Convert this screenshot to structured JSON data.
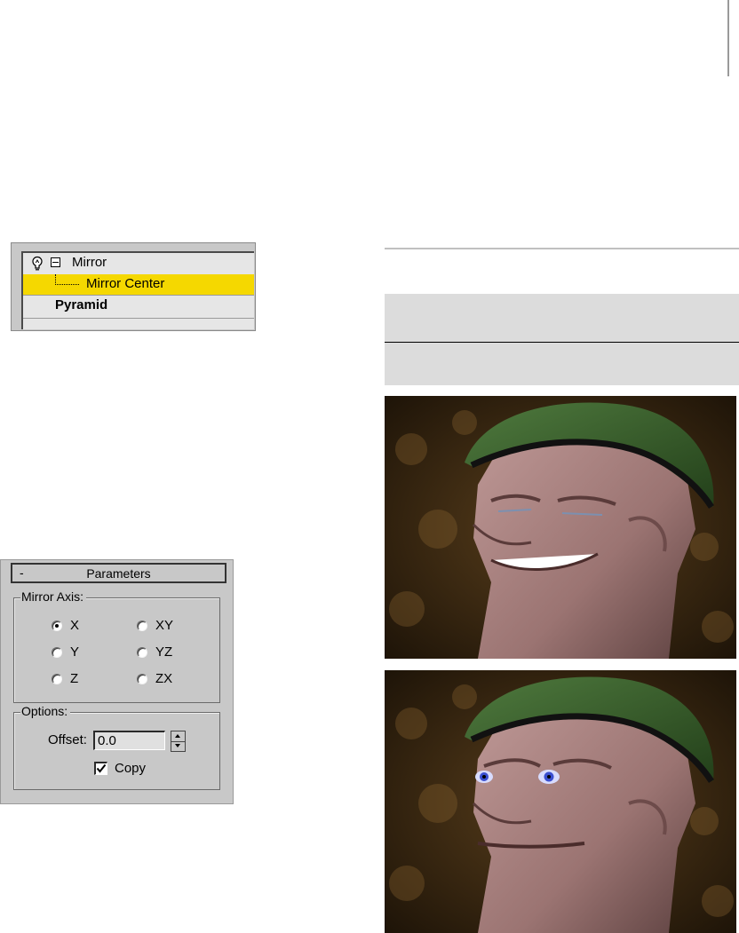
{
  "stack": {
    "items": [
      {
        "label": "Mirror",
        "expanded": true
      },
      {
        "label": "Mirror Center",
        "selected": true
      },
      {
        "label": "Pyramid"
      }
    ],
    "selected_color": "#f5d800"
  },
  "parameters": {
    "collapse_glyph": "-",
    "title": "Parameters",
    "mirror_axis": {
      "label": "Mirror Axis:",
      "options": [
        "X",
        "Y",
        "Z",
        "XY",
        "YZ",
        "ZX"
      ],
      "selected": "X"
    },
    "options": {
      "label": "Options:",
      "offset_label": "Offset:",
      "offset_value": "0.0",
      "copy_label": "Copy",
      "copy_checked": true
    }
  },
  "renders": [
    {
      "name": "render-before"
    },
    {
      "name": "render-after"
    }
  ]
}
